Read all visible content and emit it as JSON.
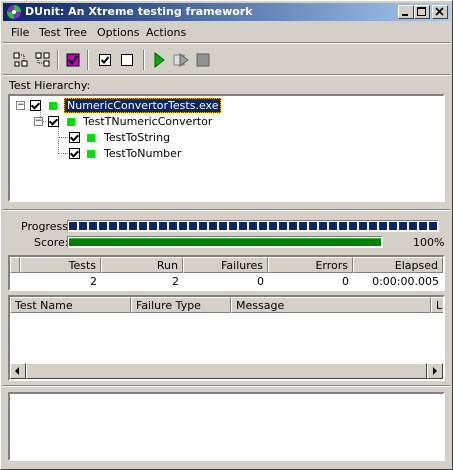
{
  "window": {
    "title": "DUnit: An Xtreme testing framework"
  },
  "menu": [
    {
      "label": "File",
      "mnemonic": "F"
    },
    {
      "label": "Test Tree",
      "mnemonic": "T"
    },
    {
      "label": "Options",
      "mnemonic": "O"
    },
    {
      "label": "Actions",
      "mnemonic": "A"
    }
  ],
  "toolbar": {
    "items": [
      "select-all-icon",
      "deselect-all-icon",
      "select-failed-icon",
      "check-icon",
      "uncheck-icon",
      "run-icon",
      "run-selected-icon",
      "stop-icon"
    ]
  },
  "tree": {
    "label": "Test Hierarchy:",
    "nodes": [
      {
        "name": "NumericConvertorTests.exe",
        "checked": true,
        "status": "passed",
        "selected": true
      },
      {
        "name": "TestTNumericConvertor",
        "checked": true,
        "status": "passed"
      },
      {
        "name": "TestToString",
        "checked": true,
        "status": "passed"
      },
      {
        "name": "TestToNumber",
        "checked": true,
        "status": "passed"
      }
    ]
  },
  "progress": {
    "progress_label": "Progress:",
    "score_label": "Score:",
    "progress_fraction": 1.0,
    "score_fraction": 1.0,
    "score_text": "100%"
  },
  "summary": {
    "headers": [
      "Tests",
      "Run",
      "Failures",
      "Errors",
      "Elapsed"
    ],
    "values": [
      "2",
      "2",
      "0",
      "0",
      "0:00:00.005"
    ]
  },
  "failures": {
    "headers": [
      "Test Name",
      "Failure Type",
      "Message",
      "L"
    ]
  },
  "colors": {
    "titlebar_start": "#0a246a",
    "titlebar_end": "#a6caf0",
    "progress_blue": "#0a246a",
    "score_green": "#008000",
    "passed_green": "#00e000"
  }
}
